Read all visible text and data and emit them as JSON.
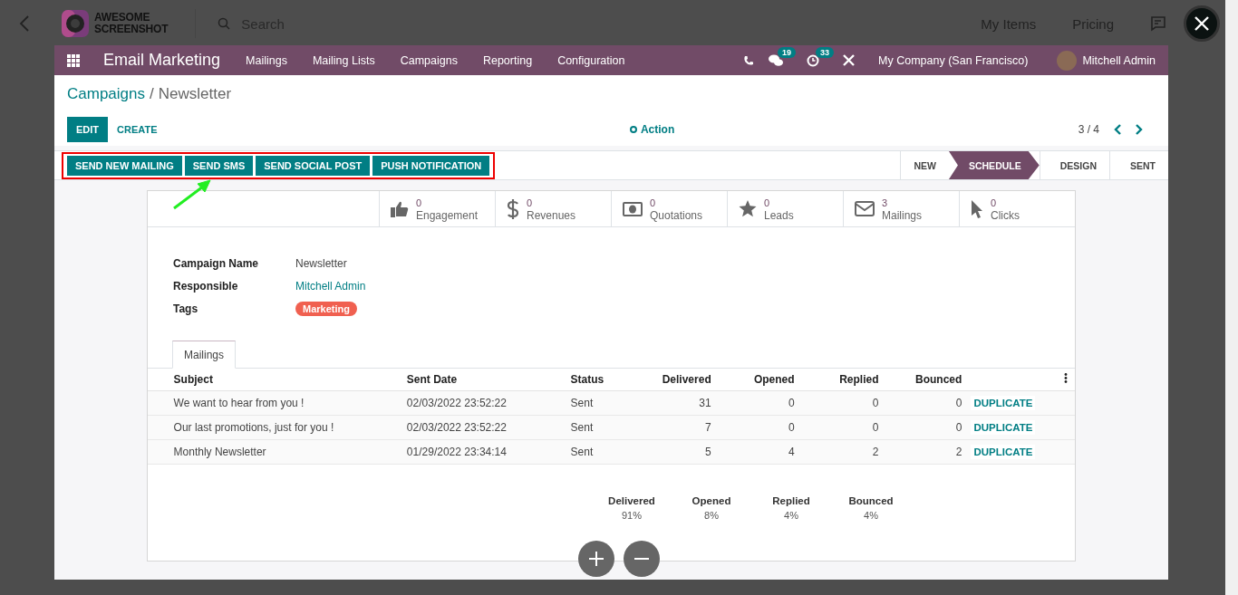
{
  "viewer": {
    "logo": [
      "AWESOME",
      "SCREENSHOT"
    ],
    "search_placeholder": "Search",
    "links": [
      "My Items",
      "Pricing"
    ]
  },
  "app": {
    "title": "Email Marketing",
    "menu": [
      "Mailings",
      "Mailing Lists",
      "Campaigns",
      "Reporting",
      "Configuration"
    ],
    "chat_count": "19",
    "activity_count": "33",
    "company": "My Company (San Francisco)",
    "user": "Mitchell Admin"
  },
  "breadcrumb": {
    "parent": "Campaigns",
    "separator": "/",
    "current": "Newsletter"
  },
  "actions": {
    "edit": "EDIT",
    "create": "CREATE",
    "action": "Action",
    "pager": "3 / 4"
  },
  "header_buttons": [
    "SEND NEW MAILING",
    "SEND SMS",
    "SEND SOCIAL POST",
    "PUSH NOTIFICATION"
  ],
  "stages": [
    {
      "label": "NEW",
      "selected": false
    },
    {
      "label": "SCHEDULE",
      "selected": true
    },
    {
      "label": "DESIGN",
      "selected": false
    },
    {
      "label": "SENT",
      "selected": false
    }
  ],
  "stat_buttons": [
    {
      "kind": "thumbs",
      "value": "0",
      "label": "Engagement"
    },
    {
      "kind": "dollar",
      "value": "0",
      "label": "Revenues"
    },
    {
      "kind": "money",
      "value": "0",
      "label": "Quotations"
    },
    {
      "kind": "star",
      "value": "0",
      "label": "Leads"
    },
    {
      "kind": "envelope",
      "value": "3",
      "label": "Mailings"
    },
    {
      "kind": "pointer",
      "value": "0",
      "label": "Clicks"
    }
  ],
  "fields": [
    {
      "kind": "text",
      "label": "Campaign Name",
      "value": "Newsletter"
    },
    {
      "kind": "link",
      "label": "Responsible",
      "value": "Mitchell Admin"
    },
    {
      "kind": "tag",
      "label": "Tags",
      "value": "Marketing"
    }
  ],
  "tabs": [
    {
      "label": "Mailings",
      "selected": true
    }
  ],
  "table": {
    "columns": [
      "Subject",
      "Sent Date",
      "Status",
      "Delivered",
      "Opened",
      "Replied",
      "Bounced"
    ],
    "rows": [
      {
        "cells": [
          "We want to hear from you !",
          "02/03/2022 23:52:22",
          "Sent",
          "31",
          "0",
          "0",
          "0"
        ],
        "action": "DUPLICATE"
      },
      {
        "cells": [
          "Our last promotions, just for you !",
          "02/03/2022 23:52:22",
          "Sent",
          "7",
          "0",
          "0",
          "0"
        ],
        "action": "DUPLICATE"
      },
      {
        "cells": [
          "Monthly Newsletter",
          "01/29/2022 23:34:14",
          "Sent",
          "5",
          "4",
          "2",
          "2"
        ],
        "action": "DUPLICATE"
      }
    ]
  },
  "summary": [
    {
      "label": "Delivered",
      "value": "91%"
    },
    {
      "label": "Opened",
      "value": "8%"
    },
    {
      "label": "Replied",
      "value": "4%"
    },
    {
      "label": "Bounced",
      "value": "4%"
    }
  ]
}
